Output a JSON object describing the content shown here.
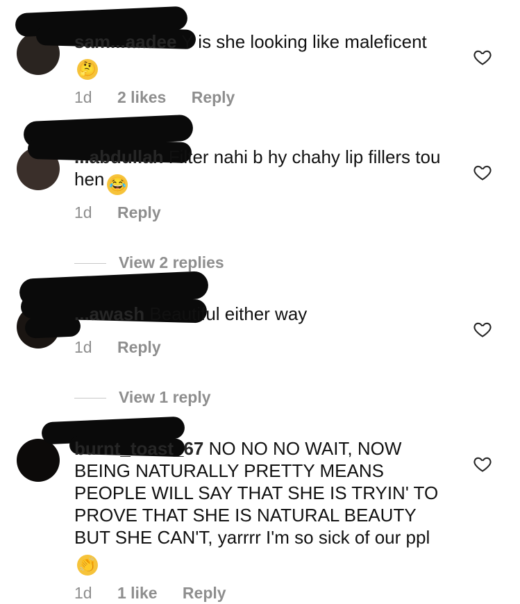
{
  "comments": [
    {
      "username": "sam...aadee",
      "text": " Y is she looking like maleficent",
      "emoji": "🤔",
      "age": "1d",
      "likes": "2 likes",
      "reply": "Reply"
    },
    {
      "username": "...abdullah",
      "text": " Filter nahi b hy chahy lip fillers tou hen",
      "emoji": "😂",
      "age": "1d",
      "likes": "",
      "reply": "Reply",
      "view_replies": "View 2 replies"
    },
    {
      "username": "...awash",
      "text": " Beautiful either way",
      "emoji": "",
      "age": "1d",
      "likes": "",
      "reply": "Reply",
      "view_replies": "View 1 reply"
    },
    {
      "username": "burnt_toast_67",
      "text": " NO NO NO WAIT, NOW BEING NATURALLY PRETTY MEANS PEOPLE WILL SAY THAT SHE IS TRYIN' TO PROVE THAT SHE IS NATURAL BEAUTY BUT SHE CAN'T, yarrrr I'm so sick of our ppl",
      "emoji": "👏",
      "age": "1d",
      "likes": "1 like",
      "reply": "Reply"
    }
  ],
  "icons": {
    "like": "heart-outline-icon"
  },
  "colors": {
    "text": "#111111",
    "meta": "#8e8e8e",
    "redaction": "#0a0a0a"
  }
}
